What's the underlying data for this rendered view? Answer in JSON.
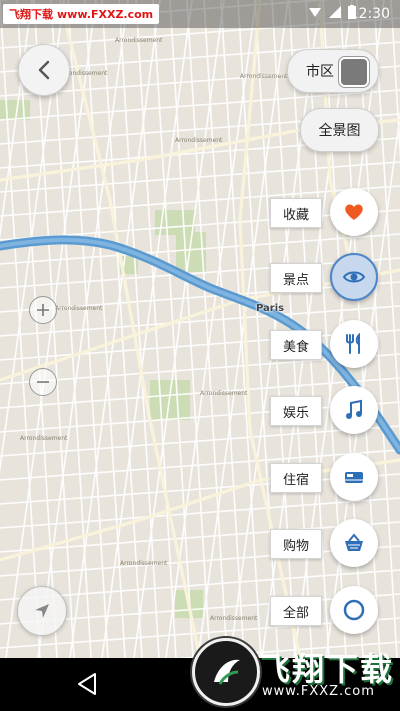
{
  "status_bar": {
    "watermark_prefix": "飞翔下载",
    "watermark_url": "www.FXXZ.com",
    "time": "12:30"
  },
  "map": {
    "city_label": "Paris"
  },
  "top_controls": {
    "district_label": "市区",
    "panorama_label": "全景图"
  },
  "categories": [
    {
      "label": "收藏",
      "icon": "heart-icon",
      "color": "#f05a22",
      "active": false
    },
    {
      "label": "景点",
      "icon": "eye-icon",
      "color": "#2f6fb8",
      "active": true
    },
    {
      "label": "美食",
      "icon": "fork-knife-icon",
      "color": "#2f6fb8",
      "active": false
    },
    {
      "label": "娱乐",
      "icon": "music-note-icon",
      "color": "#2f6fb8",
      "active": false
    },
    {
      "label": "住宿",
      "icon": "bed-icon",
      "color": "#2f6fb8",
      "active": false
    },
    {
      "label": "购物",
      "icon": "basket-icon",
      "color": "#2f6fb8",
      "active": false
    },
    {
      "label": "全部",
      "icon": "circle-icon",
      "color": "#2f6fb8",
      "active": false
    }
  ],
  "site_logo": {
    "title": "飞翔下载",
    "url": "www.FXXZ.com"
  },
  "colors": {
    "river": "#5a9ad0",
    "accent_blue": "#2f6fb8",
    "favorite_orange": "#f05a22"
  }
}
